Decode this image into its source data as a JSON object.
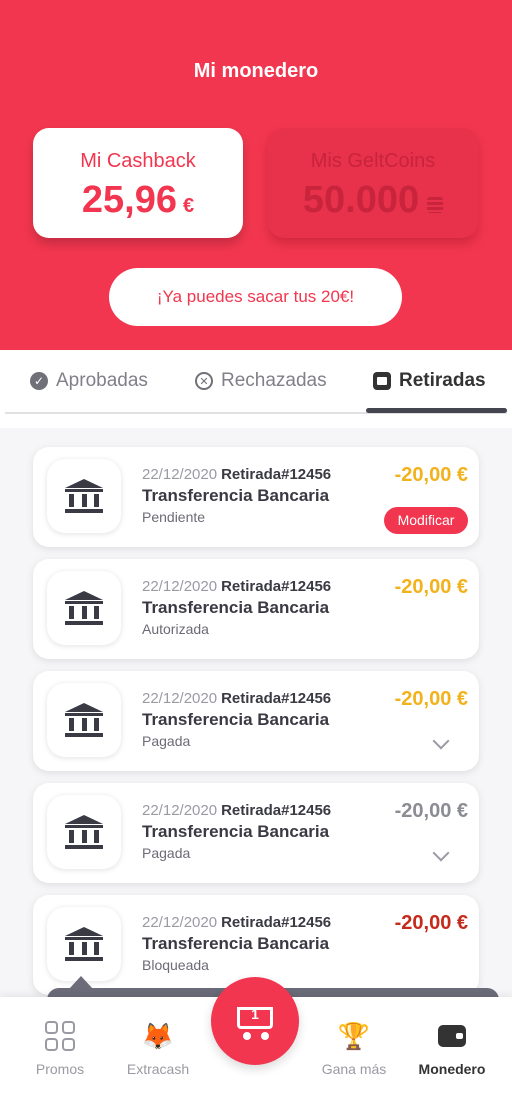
{
  "header": {
    "title": "Mi monedero",
    "cashback": {
      "label": "Mi Cashback",
      "value": "25,96",
      "unit": "€"
    },
    "geltcoins": {
      "label": "Mis GeltCoins",
      "value": "50.000",
      "unit_icon": "coin-stack-icon"
    },
    "cta_label": "¡Ya puedes sacar tus 20€!"
  },
  "tabs": [
    {
      "label": "Aprobadas",
      "icon": "check-circle-icon"
    },
    {
      "label": "Rechazadas",
      "icon": "x-circle-icon"
    },
    {
      "label": "Retiradas",
      "icon": "calendar-icon",
      "active": true
    }
  ],
  "withdrawals": [
    {
      "date": "22/12/2020",
      "ref": "Retirada#12456",
      "title": "Transferencia Bancaria",
      "status": "Pendiente",
      "amount": "-20,00 €",
      "amount_color": "#f2b21b",
      "action": "Modificar"
    },
    {
      "date": "22/12/2020",
      "ref": "Retirada#12456",
      "title": "Transferencia Bancaria",
      "status": "Autorizada",
      "amount": "-20,00 €",
      "amount_color": "#f2b21b"
    },
    {
      "date": "22/12/2020",
      "ref": "Retirada#12456",
      "title": "Transferencia Bancaria",
      "status": "Pagada",
      "amount": "-20,00 €",
      "amount_color": "#f2b21b",
      "expandable": true
    },
    {
      "date": "22/12/2020",
      "ref": "Retirada#12456",
      "title": "Transferencia Bancaria",
      "status": "Pagada",
      "amount": "-20,00 €",
      "amount_color": "#8c8c94",
      "expandable": true
    },
    {
      "date": "22/12/2020",
      "ref": "Retirada#12456",
      "title": "Transferencia Bancaria",
      "status": "Bloqueada",
      "amount": "-20,00 €",
      "amount_color": "#c42b1c"
    }
  ],
  "nav": {
    "promos": "Promos",
    "extracash": "Extracash",
    "cart_count": "1",
    "gana": "Gana más",
    "monedero": "Monedero"
  },
  "colors": {
    "brand": "#f2364f",
    "pending": "#f2b21b",
    "neutral": "#8c8c94",
    "blocked": "#c42b1c"
  }
}
